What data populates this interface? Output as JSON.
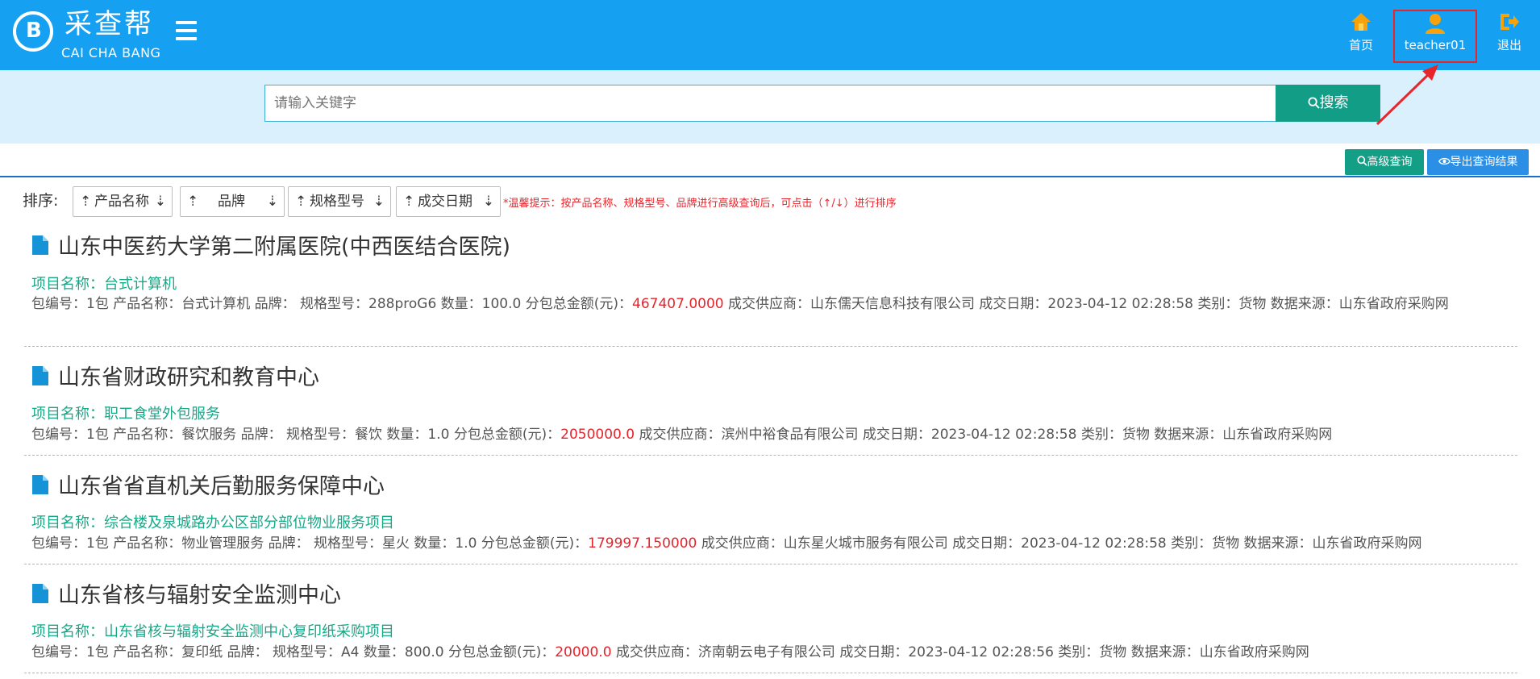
{
  "header": {
    "brand_cn": "采查帮",
    "brand_en": "CAI CHA BANG",
    "nav": [
      {
        "label": "首页",
        "icon": "home-icon"
      },
      {
        "label": "teacher01",
        "icon": "user-icon"
      },
      {
        "label": "退出",
        "icon": "logout-icon"
      }
    ]
  },
  "search": {
    "placeholder": "请输入关键字",
    "button_label": "搜索"
  },
  "toolbar": {
    "advanced_label": "高级查询",
    "export_label": "导出查询结果"
  },
  "sort": {
    "label": "排序:",
    "up_arrow": "⇡",
    "down_arrow": "⇣",
    "options": [
      "产品名称",
      "品牌",
      "规格型号",
      "成交日期"
    ],
    "tip": "*温馨提示：按产品名称、规格型号、品牌进行高级查询后，可点击（↑/↓）进行排序"
  },
  "records": [
    {
      "title": "山东中医药大学第二附属医院(中西医结合医院)",
      "project": "项目名称：台式计算机",
      "detail_before": "包编号：1包  产品名称：台式计算机  品牌：  规格型号：288proG6  数量：100.0  分包总金额(元)：",
      "amount": "467407.0000",
      "detail_after": "  成交供应商：山东儒天信息科技有限公司  成交日期：2023-04-12 02:28:58  类别：货物  数据来源：山东省政府采购网"
    },
    {
      "title": "山东省财政研究和教育中心",
      "project": "项目名称：职工食堂外包服务",
      "detail_before": "包编号：1包  产品名称：餐饮服务  品牌：  规格型号：餐饮  数量：1.0  分包总金额(元)：",
      "amount": "2050000.0",
      "detail_after": "  成交供应商：滨州中裕食品有限公司  成交日期：2023-04-12 02:28:58  类别：货物  数据来源：山东省政府采购网"
    },
    {
      "title": "山东省省直机关后勤服务保障中心",
      "project": "项目名称：综合楼及泉城路办公区部分部位物业服务项目",
      "detail_before": "包编号：1包  产品名称：物业管理服务  品牌：  规格型号：星火  数量：1.0  分包总金额(元)：",
      "amount": "179997.150000",
      "detail_after": "  成交供应商：山东星火城市服务有限公司  成交日期：2023-04-12 02:28:58  类别：货物  数据来源：山东省政府采购网"
    },
    {
      "title": "山东省核与辐射安全监测中心",
      "project": "项目名称：山东省核与辐射安全监测中心复印纸采购项目",
      "detail_before": "包编号：1包  产品名称：复印纸  品牌：  规格型号：A4  数量：800.0  分包总金额(元)：",
      "amount": "20000.0",
      "detail_after": "  成交供应商：济南朝云电子有限公司  成交日期：2023-04-12 02:28:56  类别：货物  数据来源：山东省政府采购网"
    }
  ]
}
